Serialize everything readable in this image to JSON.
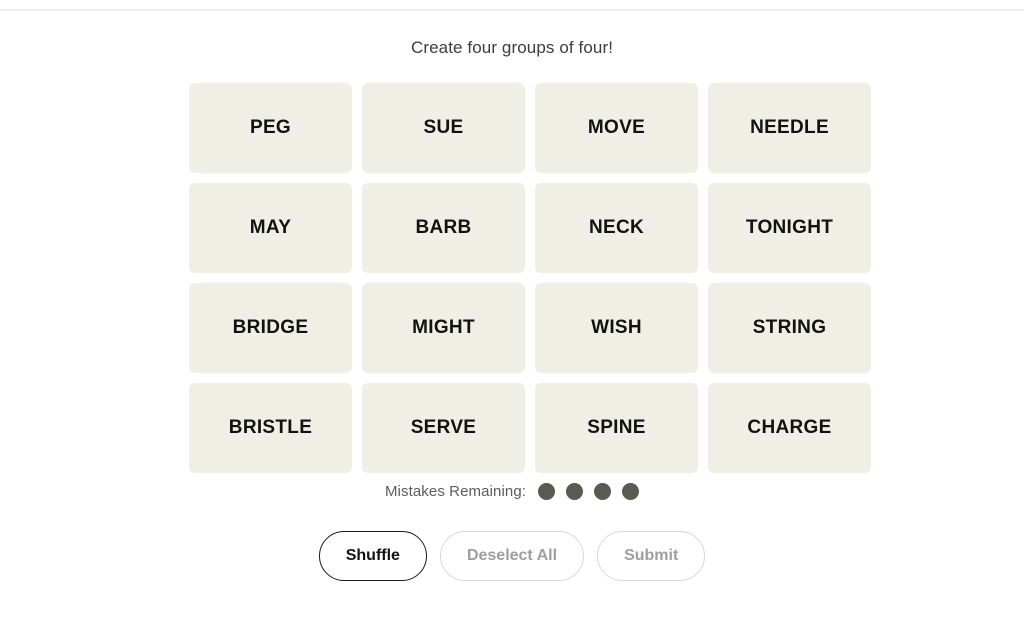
{
  "header": {
    "title": "Create four groups of four!"
  },
  "board": {
    "tiles": [
      {
        "label": "PEG"
      },
      {
        "label": "SUE"
      },
      {
        "label": "MOVE"
      },
      {
        "label": "NEEDLE"
      },
      {
        "label": "MAY"
      },
      {
        "label": "BARB"
      },
      {
        "label": "NECK"
      },
      {
        "label": "TONIGHT"
      },
      {
        "label": "BRIDGE"
      },
      {
        "label": "MIGHT"
      },
      {
        "label": "WISH"
      },
      {
        "label": "STRING"
      },
      {
        "label": "BRISTLE"
      },
      {
        "label": "SERVE"
      },
      {
        "label": "SPINE"
      },
      {
        "label": "CHARGE"
      }
    ]
  },
  "mistakes": {
    "label": "Mistakes Remaining:",
    "remaining": 4,
    "dot_color": "#5A5A50"
  },
  "controls": {
    "shuffle_label": "Shuffle",
    "deselect_label": "Deselect All",
    "submit_label": "Submit",
    "shuffle_enabled": true,
    "deselect_enabled": false,
    "submit_enabled": false
  },
  "colors": {
    "tile_background": "#EFEFE6",
    "tile_text": "#121212",
    "page_background": "#FFFFFF",
    "divider": "#EDEDED",
    "disabled_text": "#9E9E9E",
    "disabled_border": "#D8D8D8",
    "active_border": "#1A1A1A"
  }
}
